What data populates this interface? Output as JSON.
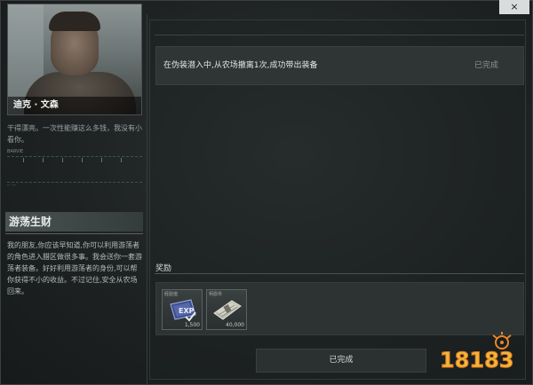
{
  "window": {
    "close_label": "×"
  },
  "character": {
    "name": "迪克 · 文森",
    "quote": "干得漂亮。一次性能赚这么多钱，我没有小看你。",
    "stats_label": "BARVIE",
    "stats_sub": "-- ---"
  },
  "mission": {
    "title": "游荡生财",
    "description": "我的朋友,你应该早知道,你可以利用游荡者的角色进入腊区做很多事。我会送你一套游荡者装备。好好利用游荡者的身份,可以帮你获得不小的收益。不过记住,安全从农场回来。"
  },
  "task": {
    "text": "在伪装潜入中,从农场撤离1次,成功带出装备",
    "status": "已完成"
  },
  "rewards": {
    "label": "奖励",
    "items": [
      {
        "name": "经验值",
        "quantity": "1,500",
        "icon": "exp-card-icon"
      },
      {
        "name": "柯恩币",
        "quantity": "40,000",
        "icon": "money-stack-icon"
      }
    ]
  },
  "actions": {
    "complete_label": "已完成"
  },
  "watermark": {
    "text": "18183"
  }
}
